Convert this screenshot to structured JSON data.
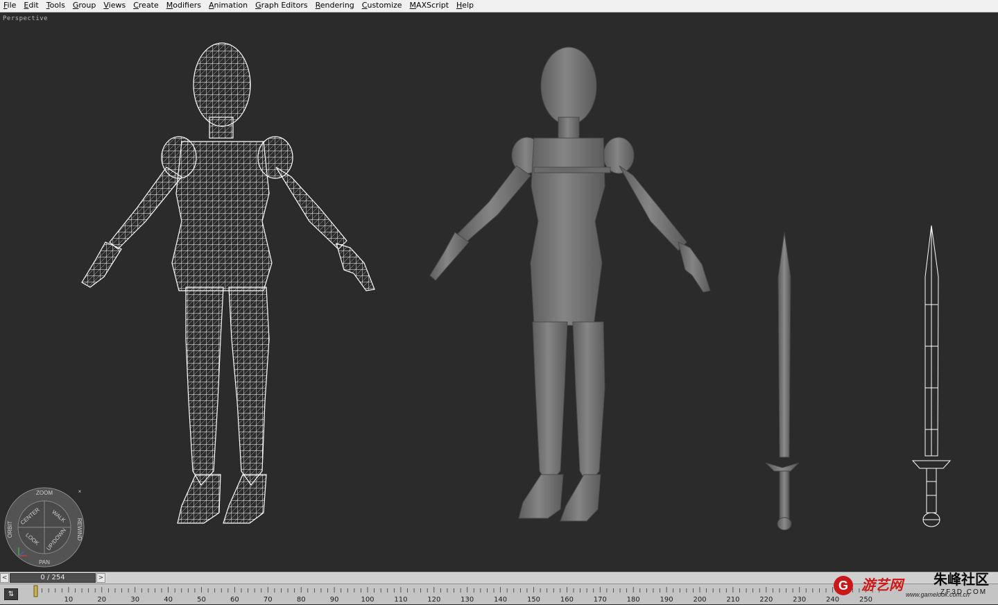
{
  "menu": {
    "items": [
      "File",
      "Edit",
      "Tools",
      "Group",
      "Views",
      "Create",
      "Modifiers",
      "Animation",
      "Graph Editors",
      "Rendering",
      "Customize",
      "MAXScript",
      "Help"
    ]
  },
  "viewport": {
    "label": "Perspective"
  },
  "steering_wheel": {
    "zoom": "ZOOM",
    "orbit": "ORBIT",
    "center": "CENTER",
    "walk": "WALK",
    "rewind": "REWIND",
    "look": "LOOK",
    "updown": "UP/DOWN",
    "pan": "PAN",
    "close": "×"
  },
  "timeline": {
    "frame_display": "0 / 254",
    "current_frame": 0,
    "total_frames": 254,
    "prev": "<",
    "next": ">",
    "ticks": [
      "10",
      "20",
      "30",
      "40",
      "50",
      "60",
      "70",
      "80",
      "90",
      "100",
      "110",
      "120",
      "130",
      "140",
      "150",
      "160",
      "170",
      "180",
      "190",
      "200",
      "210",
      "220",
      "230",
      "240",
      "250"
    ]
  },
  "watermark": {
    "brand_cn": "游艺网",
    "url": "www.gamelook.com.cn",
    "community": "朱峰社区",
    "zf": "ZF3D.COM"
  },
  "colors": {
    "viewport_bg": "#2b2b2b",
    "wireframe": "#ffffff",
    "shaded": "#7a7a7a",
    "menubar_bg": "#f0f0f0"
  }
}
